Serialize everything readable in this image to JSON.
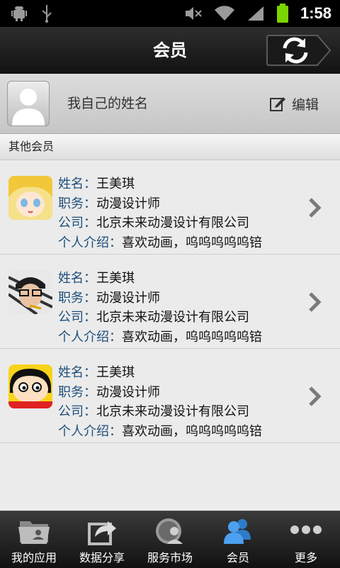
{
  "status_bar": {
    "time": "1:58",
    "icons": [
      "android-debug-icon",
      "usb-icon",
      "mute-icon",
      "wifi-icon",
      "signal-icon",
      "battery-icon"
    ]
  },
  "header": {
    "title": "会员",
    "refresh_icon": "refresh-icon"
  },
  "profile": {
    "name": "我自己的姓名",
    "edit_label": "编辑"
  },
  "section": {
    "title": "其他会员"
  },
  "members": [
    {
      "name_label": "姓名：",
      "name": "王美琪",
      "title_label": "职务：",
      "title": "动漫设计师",
      "company_label": "公司：",
      "company": "北京未来动漫设计有限公司",
      "intro_label": "个人介绍：",
      "intro": "喜欢动画，呜呜呜呜呜锫"
    },
    {
      "name_label": "姓名：",
      "name": "王美琪",
      "title_label": "职务：",
      "title": "动漫设计师",
      "company_label": "公司：",
      "company": "北京未来动漫设计有限公司",
      "intro_label": "个人介绍：",
      "intro": "喜欢动画，呜呜呜呜呜锫"
    },
    {
      "name_label": "姓名：",
      "name": "王美琪",
      "title_label": "职务：",
      "title": "动漫设计师",
      "company_label": "公司：",
      "company": "北京未来动漫设计有限公司",
      "intro_label": "个人介绍：",
      "intro": "喜欢动画，呜呜呜呜呜锫"
    }
  ],
  "bottom_nav": {
    "items": [
      {
        "label": "我的应用",
        "icon": "folder-icon"
      },
      {
        "label": "数据分享",
        "icon": "share-icon"
      },
      {
        "label": "服务市场",
        "icon": "market-icon"
      },
      {
        "label": "会员",
        "icon": "members-icon"
      },
      {
        "label": "更多",
        "icon": "more-icon"
      }
    ],
    "active_color": "#3d8fe0"
  }
}
